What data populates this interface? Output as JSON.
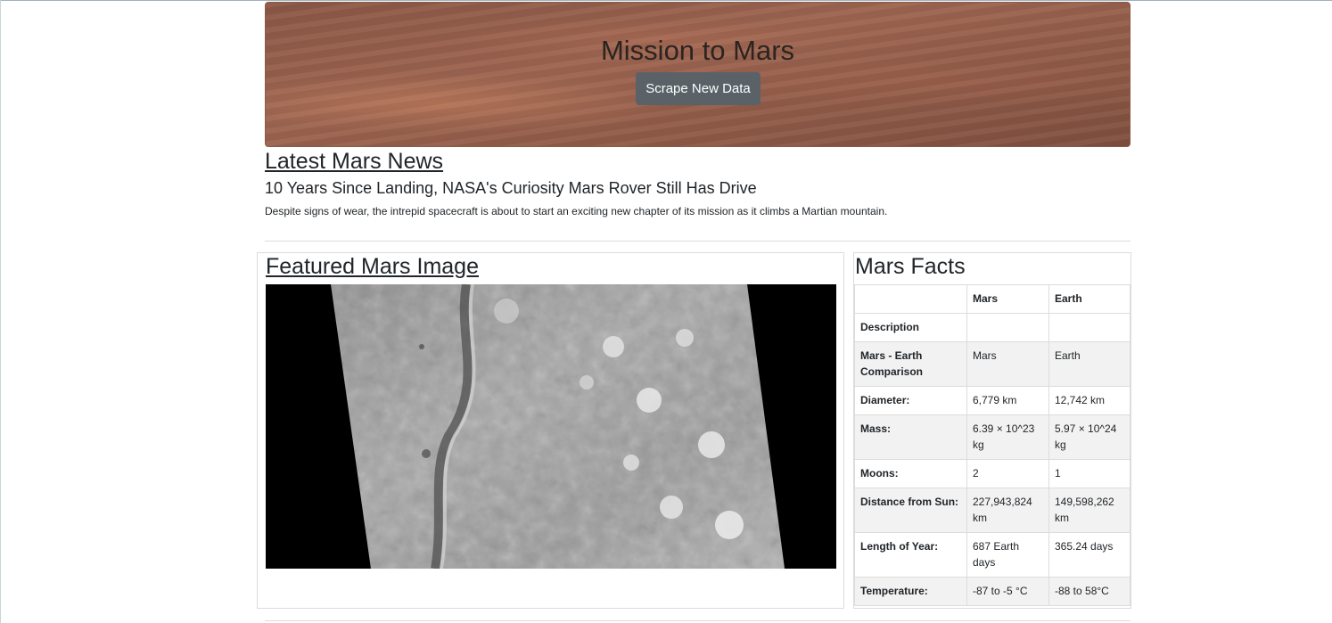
{
  "jumbotron": {
    "title": "Mission to Mars",
    "button_label": "Scrape New Data"
  },
  "news": {
    "heading": "Latest Mars News",
    "title": "10 Years Since Landing, NASA's Curiosity Mars Rover Still Has Drive",
    "paragraph": "Despite signs of wear, the intrepid spacecraft is about to start an exciting new chapter of its mission as it climbs a Martian mountain."
  },
  "featured": {
    "heading": "Featured Mars Image"
  },
  "facts": {
    "heading": "Mars Facts",
    "headers": [
      "",
      "Mars",
      "Earth"
    ],
    "rows": [
      {
        "label": "Description",
        "mars": "",
        "earth": ""
      },
      {
        "label": "Mars - Earth Comparison",
        "mars": "Mars",
        "earth": "Earth"
      },
      {
        "label": "Diameter:",
        "mars": "6,779 km",
        "earth": "12,742 km"
      },
      {
        "label": "Mass:",
        "mars": "6.39 × 10^23 kg",
        "earth": "5.97 × 10^24 kg"
      },
      {
        "label": "Moons:",
        "mars": "2",
        "earth": "1"
      },
      {
        "label": "Distance from Sun:",
        "mars": "227,943,824 km",
        "earth": "149,598,262 km"
      },
      {
        "label": "Length of Year:",
        "mars": "687 Earth days",
        "earth": "365.24 days"
      },
      {
        "label": "Temperature:",
        "mars": "-87 to -5 °C",
        "earth": "-88 to 58°C"
      }
    ]
  }
}
